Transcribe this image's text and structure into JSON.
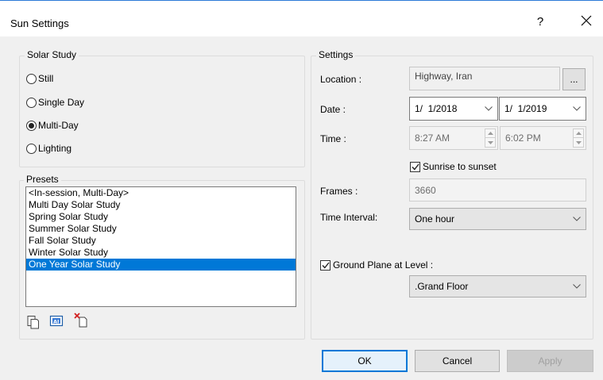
{
  "window": {
    "title": "Sun Settings",
    "help_label": "?"
  },
  "solar_study": {
    "label": "Solar Study",
    "options": [
      {
        "label": "Still",
        "selected": false
      },
      {
        "label": "Single Day",
        "selected": false
      },
      {
        "label": "Multi-Day",
        "selected": true
      },
      {
        "label": "Lighting",
        "selected": false
      }
    ]
  },
  "presets": {
    "label": "Presets",
    "items": [
      {
        "label": "<In-session, Multi-Day>",
        "selected": false
      },
      {
        "label": "Multi Day Solar Study",
        "selected": false
      },
      {
        "label": "Spring Solar Study",
        "selected": false
      },
      {
        "label": "Summer Solar Study",
        "selected": false
      },
      {
        "label": "Fall Solar Study",
        "selected": false
      },
      {
        "label": "Winter Solar Study",
        "selected": false
      },
      {
        "label": "One Year Solar Study",
        "selected": true
      }
    ],
    "toolbar_icons": [
      "duplicate-icon",
      "rename-icon",
      "delete-icon"
    ]
  },
  "settings": {
    "label": "Settings",
    "location_label": "Location :",
    "location_value": "Highway, Iran",
    "browse_label": "...",
    "date_label": "Date :",
    "date_start": "1/  1/2018",
    "date_end": "1/  1/2019",
    "time_label": "Time :",
    "time_start": "8:27 AM",
    "time_end": "6:02 PM",
    "sunrise_label": "Sunrise to sunset",
    "sunrise_checked": true,
    "frames_label": "Frames :",
    "frames_value": "3660",
    "interval_label": "Time Interval:",
    "interval_value": "One hour",
    "ground_plane_label": "Ground Plane at Level :",
    "ground_plane_checked": true,
    "level_value": ".Grand Floor"
  },
  "buttons": {
    "ok": "OK",
    "cancel": "Cancel",
    "apply": "Apply"
  },
  "colors": {
    "accent": "#0078d7",
    "selection": "#0078d7",
    "dialog_bg": "#f0f0f0"
  }
}
